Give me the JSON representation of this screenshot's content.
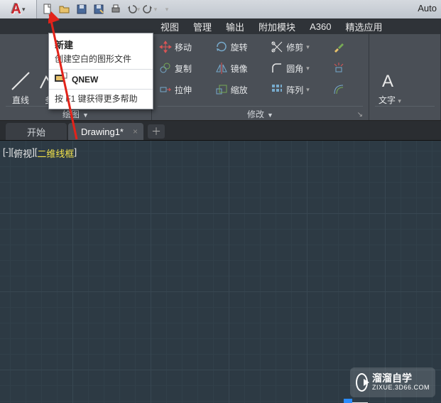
{
  "app": {
    "title": "Auto"
  },
  "menubar": [
    "视图",
    "管理",
    "输出",
    "附加模块",
    "A360",
    "精选应用"
  ],
  "tooltip": {
    "title": "新建",
    "desc": "创建空白的图形文件",
    "cmd": "QNEW",
    "help": "按 F1 键获得更多帮助"
  },
  "ribbon": {
    "draw": {
      "line": "直线",
      "more": "多",
      "panel_title": "绘图"
    },
    "modify": {
      "move": "移动",
      "rotate": "旋转",
      "trim": "修剪",
      "copy": "复制",
      "mirror": "镜像",
      "fillet": "圆角",
      "stretch": "拉伸",
      "scale": "缩放",
      "array": "阵列",
      "panel_title": "修改"
    },
    "annot": {
      "text": "文字"
    }
  },
  "tabs": {
    "start": "开始",
    "drawing": "Drawing1*"
  },
  "viewport": {
    "bracket_minus": "[-][",
    "top": "俯视",
    "mid": "][",
    "wire": "二维线框",
    "end": "]"
  },
  "watermark": {
    "title": "溜溜自学",
    "sub": "ZIXUE.3D66.COM"
  }
}
